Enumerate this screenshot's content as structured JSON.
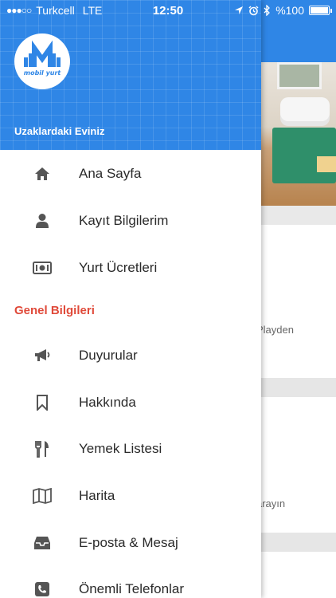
{
  "status_bar": {
    "signal": "●●●○○",
    "carrier": "Turkcell",
    "network": "LTE",
    "time": "12:50",
    "battery": "%100",
    "icons": [
      "location-arrow-icon",
      "alarm-icon",
      "bluetooth-icon",
      "battery-icon"
    ]
  },
  "drawer": {
    "logo_text": "mobil yurt",
    "subtitle": "Uzaklardaki Eviniz",
    "items": [
      {
        "label": "Ana Sayfa",
        "icon": "home-icon"
      },
      {
        "label": "Kayıt Bilgilerim",
        "icon": "user-icon"
      },
      {
        "label": "Yurt Ücretleri",
        "icon": "money-icon"
      }
    ],
    "section_title": "Genel Bilgileri",
    "section_items": [
      {
        "label": "Duyurular",
        "icon": "megaphone-icon"
      },
      {
        "label": "Hakkında",
        "icon": "bookmark-icon"
      },
      {
        "label": "Yemek Listesi",
        "icon": "utensils-icon"
      },
      {
        "label": "Harita",
        "icon": "map-icon"
      },
      {
        "label": "E-posta & Mesaj",
        "icon": "inbox-icon"
      },
      {
        "label": "Önemli Telefonlar",
        "icon": "phone-icon"
      }
    ]
  },
  "background": {
    "card1_text": "Playden",
    "card2_text": "arayın"
  },
  "colors": {
    "header_blue": "#2f86e6",
    "section_red": "#e04a3a",
    "icon_gray": "#555555"
  }
}
